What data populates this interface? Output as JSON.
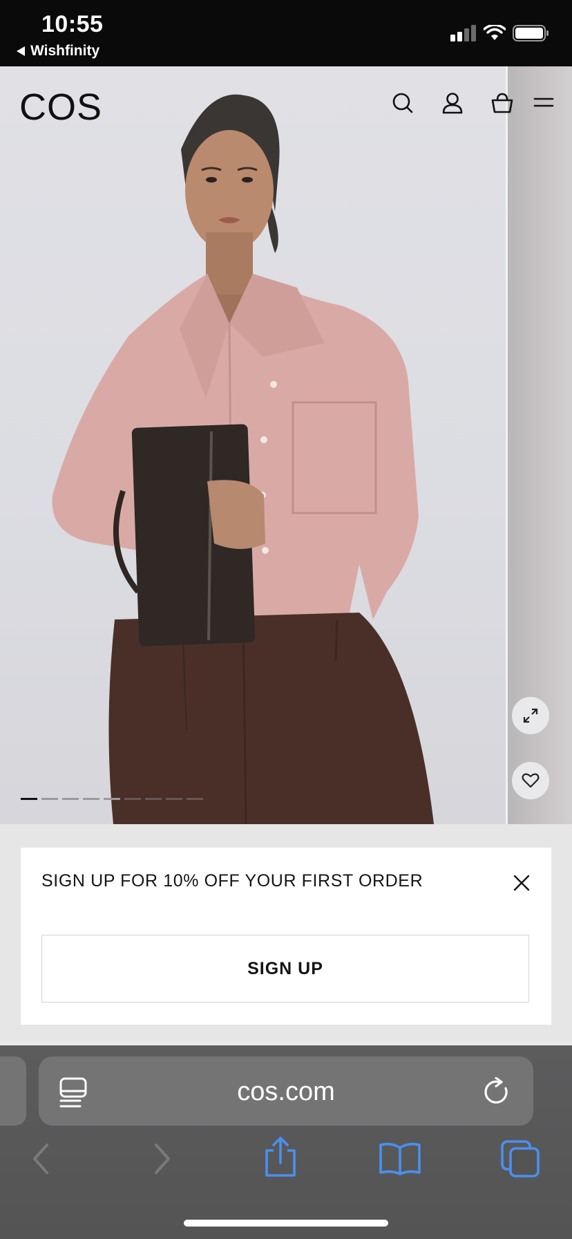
{
  "status_bar": {
    "time": "10:55",
    "back_app": "Wishfinity"
  },
  "site": {
    "logo": "COS",
    "nav_icons": [
      "search-icon",
      "account-icon",
      "basket-icon",
      "menu-icon"
    ]
  },
  "hero": {
    "carousel_position": 1,
    "actions": [
      "expand-icon",
      "heart-icon"
    ]
  },
  "signup_banner": {
    "message": "SIGN UP FOR 10% OFF YOUR FIRST ORDER",
    "button_label": "SIGN UP"
  },
  "browser": {
    "url": "cos.com",
    "toolbar_icons": [
      "back-icon",
      "forward-icon",
      "share-icon",
      "bookmarks-icon",
      "tabs-icon"
    ],
    "accent_color": "#3b82f6"
  }
}
